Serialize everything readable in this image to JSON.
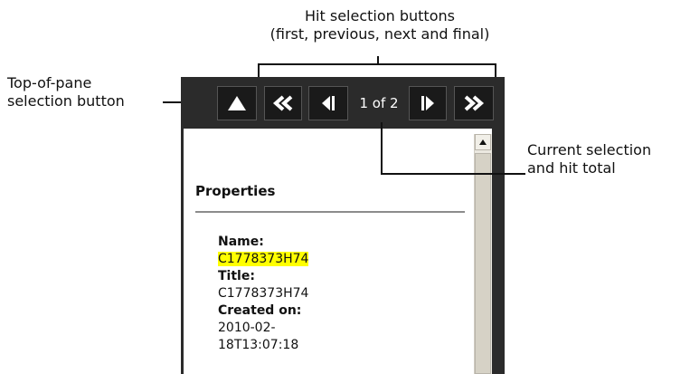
{
  "callouts": {
    "hit_selection": [
      "Hit selection buttons",
      "(first, previous, next and final)"
    ],
    "top_of_pane": [
      "Top-of-pane",
      "selection button"
    ],
    "current_selection": [
      "Current selection",
      "and hit total"
    ]
  },
  "toolbar": {
    "hit_count": "1 of 2",
    "icons": {
      "top": "triangle-up-icon",
      "first": "double-chevron-left-icon",
      "prev": "triangle-left-icon",
      "next": "triangle-right-icon",
      "last": "double-chevron-right-icon"
    }
  },
  "content": {
    "heading": "Properties",
    "properties": [
      {
        "label": "Name:",
        "value": "C1778373H74",
        "highlighted": true
      },
      {
        "label": "Title:",
        "value": "C1778373H74",
        "highlighted": false
      },
      {
        "label": "Created on:",
        "value_lines": [
          "2010-02-",
          "18T13:07:18"
        ],
        "highlighted": false
      }
    ]
  },
  "colors": {
    "toolbar_bg": "#2b2b2b",
    "highlight": "#ffff00",
    "text": "#111111"
  }
}
